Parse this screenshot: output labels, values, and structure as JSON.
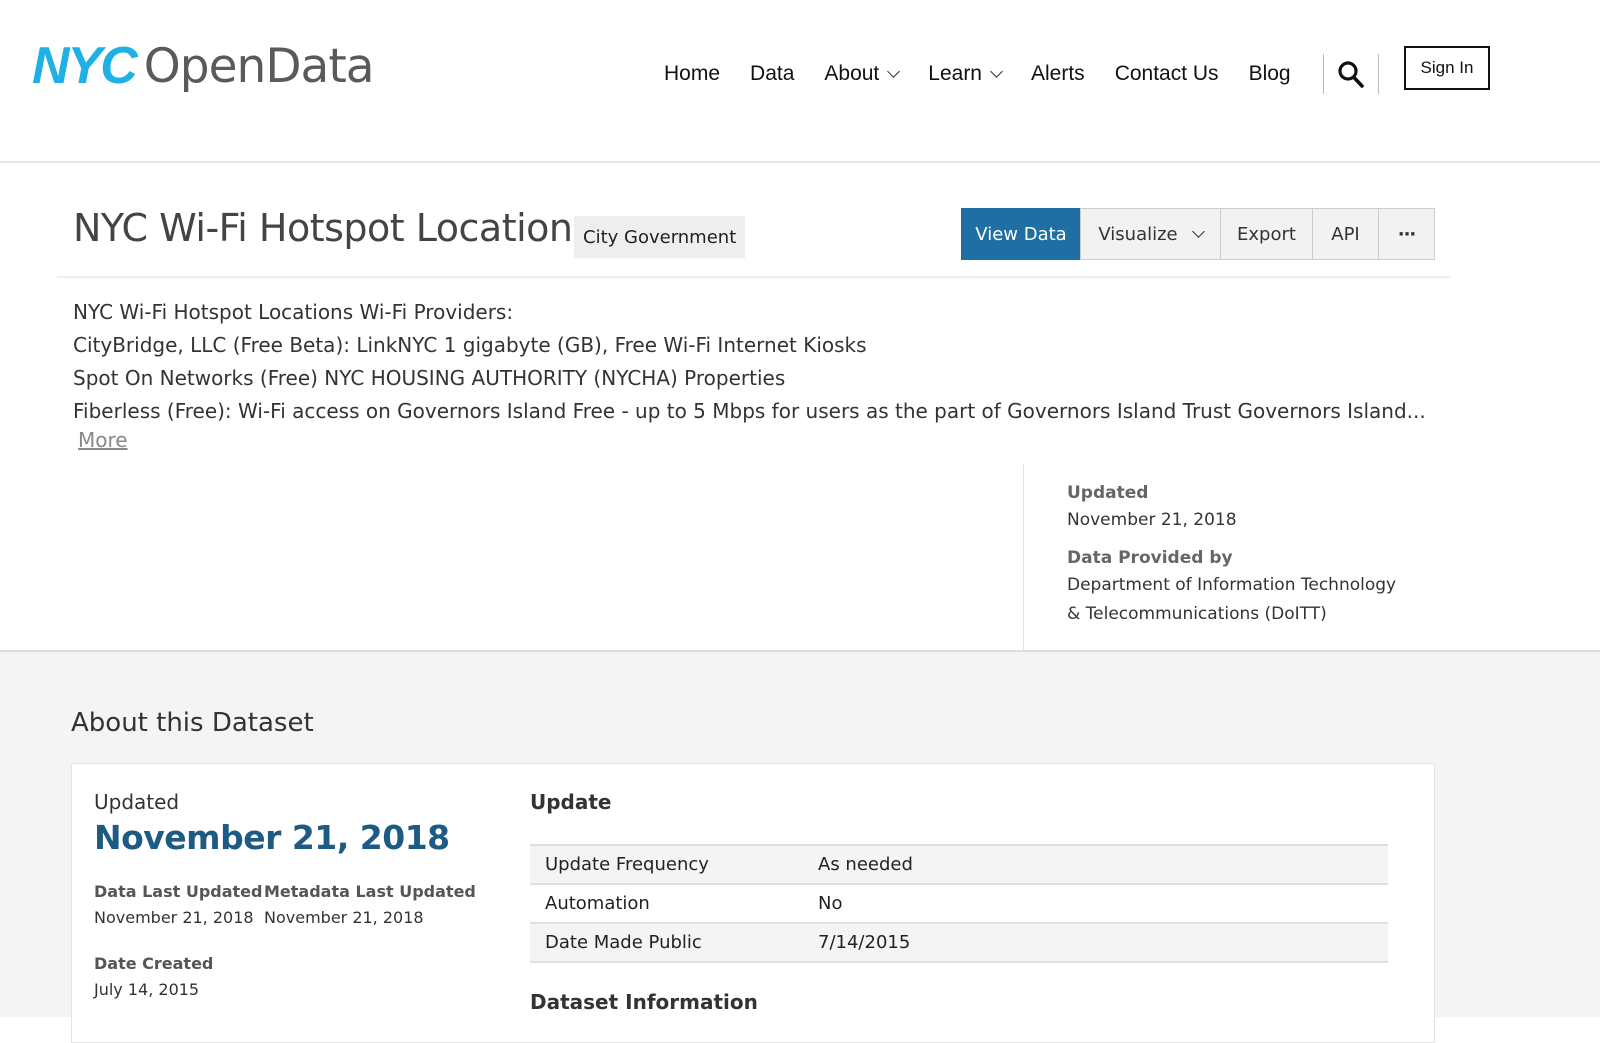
{
  "header": {
    "logo": {
      "nyc": "NYC",
      "open": "OpenData"
    },
    "nav": [
      {
        "label": "Home",
        "dropdown": false
      },
      {
        "label": "Data",
        "dropdown": false
      },
      {
        "label": "About",
        "dropdown": true
      },
      {
        "label": "Learn",
        "dropdown": true
      },
      {
        "label": "Alerts",
        "dropdown": false
      },
      {
        "label": "Contact Us",
        "dropdown": false
      },
      {
        "label": "Blog",
        "dropdown": false
      }
    ],
    "search_icon": "search-icon",
    "sign_in": "Sign In"
  },
  "dataset": {
    "title": "NYC Wi-Fi Hotspot Locations",
    "category": "City Government",
    "actions": {
      "view_data": "View Data",
      "visualize": "Visualize",
      "export": "Export",
      "api": "API",
      "more": "···"
    },
    "description": [
      "NYC Wi-Fi Hotspot Locations Wi-Fi Providers:",
      "CityBridge, LLC (Free Beta): LinkNYC 1 gigabyte (GB), Free Wi-Fi Internet Kiosks",
      "Spot On Networks (Free) NYC HOUSING AUTHORITY (NYCHA) Properties",
      "Fiberless (Free): Wi-Fi access on Governors Island Free - up to 5 Mbps for users as the part of Governors Island Trust Governors Island..."
    ],
    "more_link": "More",
    "meta": {
      "updated_label": "Updated",
      "updated_value": "November 21, 2018",
      "provided_label": "Data Provided by",
      "provided_line1": "Department of Information Technology",
      "provided_line2": "& Telecommunications (DoITT)"
    }
  },
  "about": {
    "title": "About this Dataset",
    "updated_label": "Updated",
    "updated_big": "November 21, 2018",
    "data_last_updated_label": "Data Last Updated",
    "data_last_updated_value": "November 21, 2018",
    "metadata_last_updated_label": "Metadata Last Updated",
    "metadata_last_updated_value": "November 21, 2018",
    "date_created_label": "Date Created",
    "date_created_value": "July 14, 2015",
    "update_section_title": "Update",
    "update_rows": [
      {
        "key": "Update Frequency",
        "value": "As needed"
      },
      {
        "key": "Automation",
        "value": "No"
      },
      {
        "key": "Date Made Public",
        "value": "7/14/2015"
      }
    ],
    "next_section_title": "Dataset Information"
  },
  "colors": {
    "brand_blue": "#1fb0e6",
    "primary_button": "#1f6fa5",
    "date_highlight": "#1d5b84"
  }
}
